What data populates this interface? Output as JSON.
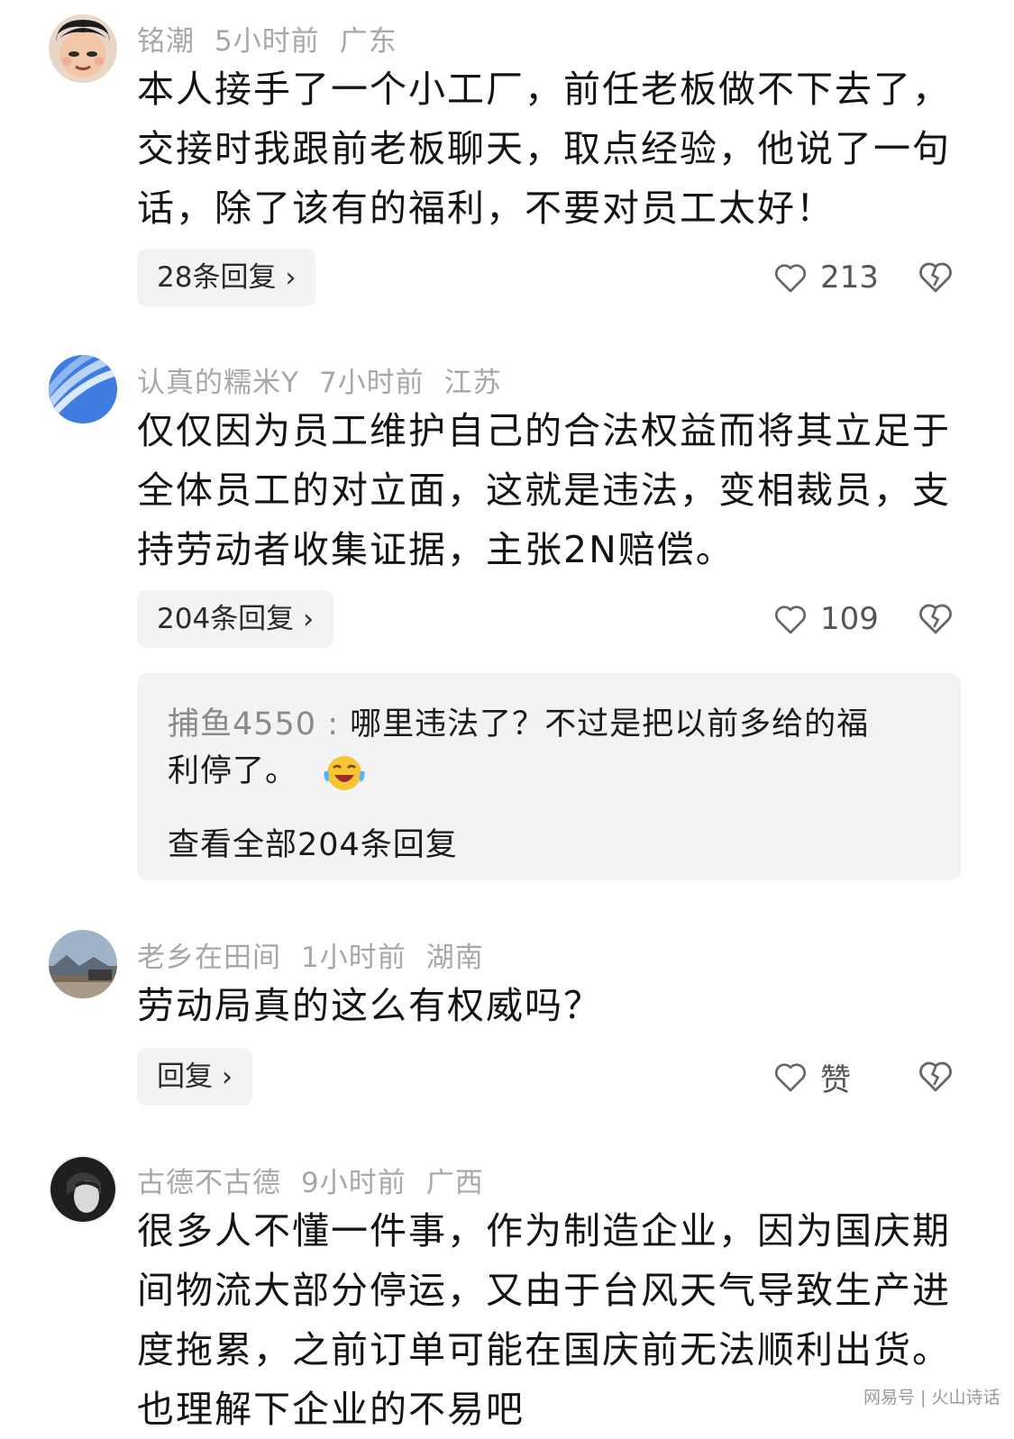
{
  "comments": [
    {
      "username": "铭潮",
      "time": "5小时前",
      "location": "广东",
      "lines": [
        "本人接手了一个小工厂，前任老板做不下去了，",
        "交接时我跟前老板聊天，取点经验，他说了一句",
        "话，除了该有的福利，不要对员工太好！"
      ],
      "reply_label": "28条回复",
      "likes": "213"
    },
    {
      "username": "认真的糯米Y",
      "time": "7小时前",
      "location": "江苏",
      "lines": [
        "仅仅因为员工维护自己的合法权益而将其立足于",
        "全体员工的对立面，这就是违法，变相裁员，支",
        "持劳动者收集证据，主张2N赔偿。"
      ],
      "reply_label": "204条回复",
      "likes": "109",
      "sub_reply": {
        "name": "捕鱼4550",
        "separator": " : ",
        "line1": "哪里违法了？不过是把以前多给的福",
        "line2": "利停了。",
        "view_all": "查看全部204条回复"
      }
    },
    {
      "username": "老乡在田间",
      "time": "1小时前",
      "location": "湖南",
      "lines": [
        "劳动局真的这么有权威吗？"
      ],
      "reply_label": "回复",
      "likes": "赞"
    },
    {
      "username": "古德不古德",
      "time": "9小时前",
      "location": "广西",
      "lines": [
        "很多人不懂一件事，作为制造企业，因为国庆期",
        "间物流大部分停运，又由于台风天气导致生产进",
        "度拖累，之前订单可能在国庆前无法顺利出货。",
        "也理解下企业的不易吧"
      ]
    }
  ],
  "watermark": "网易号 | 火山诗话",
  "colors": {
    "meta": "#a7a7a7",
    "reply_bg": "#f3f3f5",
    "text": "#141414"
  }
}
